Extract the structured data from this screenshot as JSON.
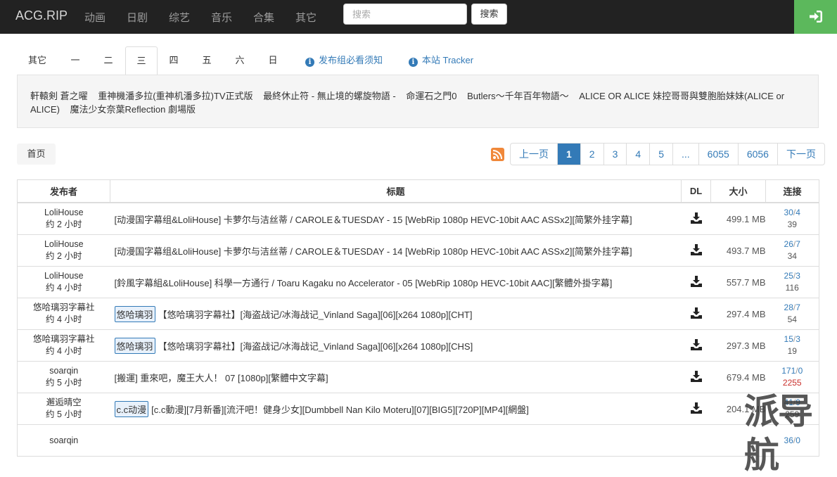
{
  "nav": {
    "brand": "ACG.RIP",
    "links": [
      "动画",
      "日剧",
      "综艺",
      "音乐",
      "合集",
      "其它"
    ],
    "search_placeholder": "搜索",
    "search_button": "搜索"
  },
  "tabs": {
    "items": [
      "其它",
      "一",
      "二",
      "三",
      "四",
      "五",
      "六",
      "日"
    ],
    "active": "三",
    "notice": "发布组必看须知",
    "tracker": "本站 Tracker"
  },
  "schedule": [
    "軒轅剣 蒼之曜",
    "重神機潘多拉(重神机潘多拉)TV正式版",
    "最終休止符 - 無止境的螺旋物語 -",
    "命運石之門0",
    "Butlers～千年百年物語～",
    "ALICE OR ALICE 妹控哥哥與雙胞胎妹妹(ALICE or ALICE)",
    "魔法少女奈葉Reflection 劇場版"
  ],
  "breadcrumb": "首页",
  "pagination": [
    "上一页",
    "1",
    "2",
    "3",
    "4",
    "5",
    "...",
    "6055",
    "6056",
    "下一页"
  ],
  "pagination_active": "1",
  "table": {
    "headers": {
      "publisher": "发布者",
      "title": "标题",
      "dl": "DL",
      "size": "大小",
      "conn": "连接"
    },
    "rows": [
      {
        "publisher": "LoliHouse",
        "time": "约 2 小时",
        "team": "",
        "title": "[动漫国字幕组&LoliHouse] 卡萝尔与洁丝蒂 / CAROLE＆TUESDAY - 15 [WebRip 1080p HEVC-10bit AAC ASSx2][简繁外挂字幕]",
        "size": "499.1 MB",
        "seed": "30",
        "leech": "4",
        "done": "39"
      },
      {
        "publisher": "LoliHouse",
        "time": "约 2 小时",
        "team": "",
        "title": "[动漫国字幕组&LoliHouse] 卡萝尔与洁丝蒂 / CAROLE＆TUESDAY - 14 [WebRip 1080p HEVC-10bit AAC ASSx2][简繁外挂字幕]",
        "size": "493.7 MB",
        "seed": "26",
        "leech": "7",
        "done": "34"
      },
      {
        "publisher": "LoliHouse",
        "time": "约 4 小时",
        "team": "",
        "title": "[鈴風字幕組&LoliHouse] 科學一方通行 / Toaru Kagaku no Accelerator - 05 [WebRip 1080p HEVC-10bit AAC][繁體外掛字幕]",
        "size": "557.7 MB",
        "seed": "25",
        "leech": "3",
        "done": "116"
      },
      {
        "publisher": "悠哈璃羽字幕社",
        "time": "约 4 小时",
        "team": "悠哈璃羽",
        "title": "【悠哈璃羽字幕社】[海盗战记/冰海战记_Vinland Saga][06][x264 1080p][CHT]",
        "size": "297.4 MB",
        "seed": "28",
        "leech": "7",
        "done": "54"
      },
      {
        "publisher": "悠哈璃羽字幕社",
        "time": "约 4 小时",
        "team": "悠哈璃羽",
        "title": "【悠哈璃羽字幕社】[海盗战记/冰海战记_Vinland Saga][06][x264 1080p][CHS]",
        "size": "297.3 MB",
        "seed": "15",
        "leech": "3",
        "done": "19"
      },
      {
        "publisher": "soarqin",
        "time": "约 5 小时",
        "team": "",
        "title": "[搬運] 重來吧，魔王大人！ 07 [1080p][繁體中文字幕]",
        "size": "679.4 MB",
        "seed": "171",
        "leech": "0",
        "done": "2255"
      },
      {
        "publisher": "邂逅晴空",
        "time": "约 5 小时",
        "team": "c.c动漫",
        "title": "[c.c動漫][7月新番][流汗吧！健身少女][Dumbbell Nan Kilo Moteru][07][BIG5][720P][MP4][網盤]",
        "size": "204.1 MB",
        "seed": "41",
        "leech": "9",
        "done": "259"
      },
      {
        "publisher": "soarqin",
        "time": "",
        "team": "",
        "title": "",
        "size": "",
        "seed": "36",
        "leech": "0",
        "done": ""
      }
    ]
  },
  "watermark": "派导航"
}
